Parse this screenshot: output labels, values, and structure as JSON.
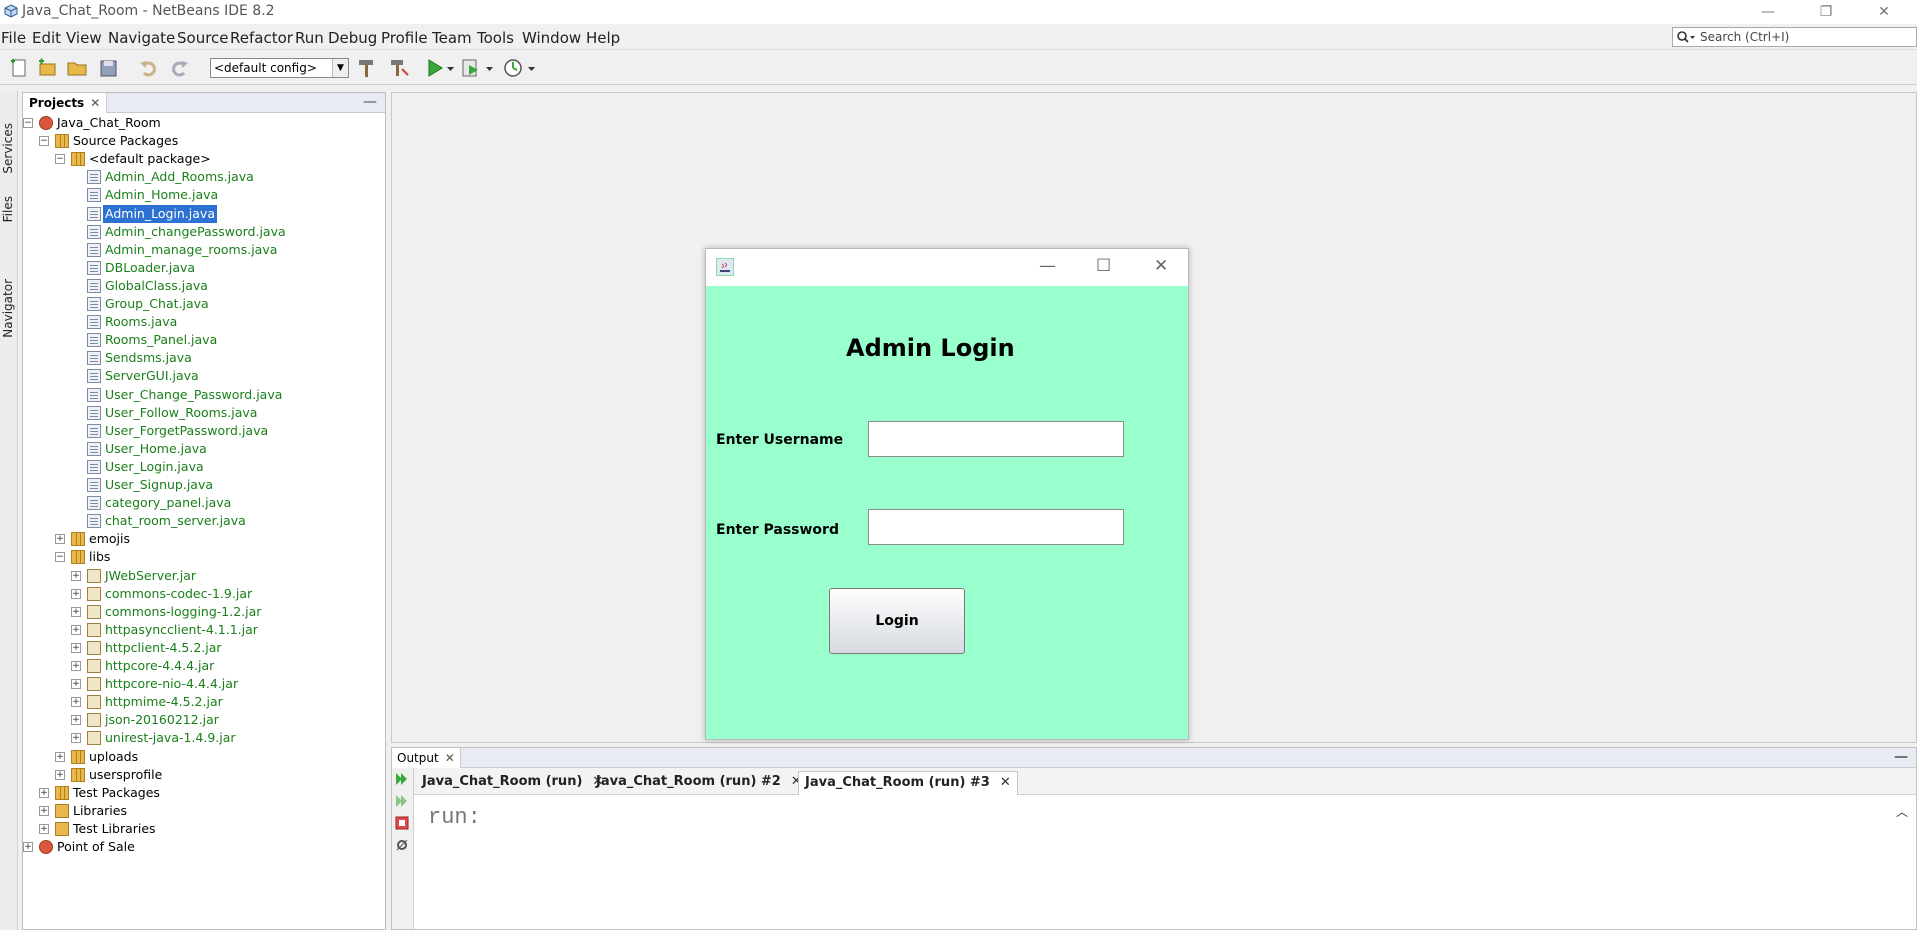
{
  "window": {
    "title": "Java_Chat_Room - NetBeans IDE 8.2",
    "minimize_glyph": "—",
    "restore_glyph": "❐",
    "close_glyph": "✕"
  },
  "menu": [
    "File",
    "Edit",
    "View",
    "Navigate",
    "Source",
    "Refactor",
    "Run",
    "Debug",
    "Profile",
    "Team",
    "Tools",
    "Window",
    "Help"
  ],
  "search": {
    "placeholder": "Search (Ctrl+I)"
  },
  "toolbar": {
    "config": "<default config>"
  },
  "side_tabs": [
    "Services",
    "Files",
    "Navigator"
  ],
  "projects_panel": {
    "title": "Projects",
    "close_glyph": "✕",
    "minimize_glyph": "—",
    "tree": [
      {
        "label": "Java_Chat_Room",
        "depth": 0,
        "toggle": "−",
        "icon": "project-icon",
        "kind": "node"
      },
      {
        "label": "Source Packages",
        "depth": 1,
        "toggle": "−",
        "icon": "source-packages-icon",
        "kind": "node"
      },
      {
        "label": "<default package>",
        "depth": 2,
        "toggle": "−",
        "icon": "package-icon",
        "kind": "node"
      },
      {
        "label": "Admin_Add_Rooms.java",
        "depth": 3,
        "icon": "java-form-icon",
        "kind": "file"
      },
      {
        "label": "Admin_Home.java",
        "depth": 3,
        "icon": "java-form-icon",
        "kind": "file"
      },
      {
        "label": "Admin_Login.java",
        "depth": 3,
        "icon": "java-form-icon",
        "kind": "file",
        "selected": true
      },
      {
        "label": "Admin_changePassword.java",
        "depth": 3,
        "icon": "java-form-icon",
        "kind": "file"
      },
      {
        "label": "Admin_manage_rooms.java",
        "depth": 3,
        "icon": "java-form-icon",
        "kind": "file"
      },
      {
        "label": "DBLoader.java",
        "depth": 3,
        "icon": "java-class-icon",
        "kind": "file"
      },
      {
        "label": "GlobalClass.java",
        "depth": 3,
        "icon": "java-class-icon",
        "kind": "file"
      },
      {
        "label": "Group_Chat.java",
        "depth": 3,
        "icon": "java-form-icon",
        "kind": "file"
      },
      {
        "label": "Rooms.java",
        "depth": 3,
        "icon": "java-class-icon",
        "kind": "file"
      },
      {
        "label": "Rooms_Panel.java",
        "depth": 3,
        "icon": "java-form-icon",
        "kind": "file"
      },
      {
        "label": "Sendsms.java",
        "depth": 3,
        "icon": "java-class-icon",
        "kind": "file"
      },
      {
        "label": "ServerGUI.java",
        "depth": 3,
        "icon": "java-form-icon",
        "kind": "file"
      },
      {
        "label": "User_Change_Password.java",
        "depth": 3,
        "icon": "java-form-icon",
        "kind": "file"
      },
      {
        "label": "User_Follow_Rooms.java",
        "depth": 3,
        "icon": "java-form-icon",
        "kind": "file"
      },
      {
        "label": "User_ForgetPassword.java",
        "depth": 3,
        "icon": "java-form-icon",
        "kind": "file"
      },
      {
        "label": "User_Home.java",
        "depth": 3,
        "icon": "java-form-icon",
        "kind": "file"
      },
      {
        "label": "User_Login.java",
        "depth": 3,
        "icon": "java-form-icon",
        "kind": "file"
      },
      {
        "label": "User_Signup.java",
        "depth": 3,
        "icon": "java-form-icon",
        "kind": "file"
      },
      {
        "label": "category_panel.java",
        "depth": 3,
        "icon": "java-form-icon",
        "kind": "file"
      },
      {
        "label": "chat_room_server.java",
        "depth": 3,
        "icon": "java-class-icon",
        "kind": "file"
      },
      {
        "label": "emojis",
        "depth": 2,
        "toggle": "+",
        "icon": "package-icon",
        "kind": "node"
      },
      {
        "label": "libs",
        "depth": 2,
        "toggle": "−",
        "icon": "package-icon",
        "kind": "node"
      },
      {
        "label": "JWebServer.jar",
        "depth": 3,
        "toggle": "+",
        "icon": "jar-icon",
        "kind": "file"
      },
      {
        "label": "commons-codec-1.9.jar",
        "depth": 3,
        "toggle": "+",
        "icon": "jar-icon",
        "kind": "file"
      },
      {
        "label": "commons-logging-1.2.jar",
        "depth": 3,
        "toggle": "+",
        "icon": "jar-icon",
        "kind": "file"
      },
      {
        "label": "httpasyncclient-4.1.1.jar",
        "depth": 3,
        "toggle": "+",
        "icon": "jar-icon",
        "kind": "file"
      },
      {
        "label": "httpclient-4.5.2.jar",
        "depth": 3,
        "toggle": "+",
        "icon": "jar-icon",
        "kind": "file"
      },
      {
        "label": "httpcore-4.4.4.jar",
        "depth": 3,
        "toggle": "+",
        "icon": "jar-icon",
        "kind": "file"
      },
      {
        "label": "httpcore-nio-4.4.4.jar",
        "depth": 3,
        "toggle": "+",
        "icon": "jar-icon",
        "kind": "file"
      },
      {
        "label": "httpmime-4.5.2.jar",
        "depth": 3,
        "toggle": "+",
        "icon": "jar-icon",
        "kind": "file"
      },
      {
        "label": "json-20160212.jar",
        "depth": 3,
        "toggle": "+",
        "icon": "jar-icon",
        "kind": "file"
      },
      {
        "label": "unirest-java-1.4.9.jar",
        "depth": 3,
        "toggle": "+",
        "icon": "jar-icon",
        "kind": "file"
      },
      {
        "label": "uploads",
        "depth": 2,
        "toggle": "+",
        "icon": "package-icon",
        "kind": "node"
      },
      {
        "label": "usersprofile",
        "depth": 2,
        "toggle": "+",
        "icon": "package-icon",
        "kind": "node"
      },
      {
        "label": "Test Packages",
        "depth": 1,
        "toggle": "+",
        "icon": "test-packages-icon",
        "kind": "node"
      },
      {
        "label": "Libraries",
        "depth": 1,
        "toggle": "+",
        "icon": "libraries-icon",
        "kind": "node"
      },
      {
        "label": "Test Libraries",
        "depth": 1,
        "toggle": "+",
        "icon": "test-libraries-icon",
        "kind": "node"
      },
      {
        "label": "Point of Sale",
        "depth": 0,
        "toggle": "+",
        "icon": "project-icon",
        "kind": "node"
      }
    ]
  },
  "login_window": {
    "title": "Admin Login",
    "username_label": "Enter Username",
    "username_value": "",
    "password_label": "Enter Password",
    "password_value": "",
    "login_button": "Login",
    "minimize_glyph": "—",
    "maximize_glyph": "☐",
    "close_glyph": "✕",
    "background_color": "#99ffcc"
  },
  "output_panel": {
    "title": "Output",
    "close_glyph": "✕",
    "minimize_glyph": "—",
    "tabs": [
      {
        "label": "Java_Chat_Room (run)",
        "active": false
      },
      {
        "label": "Java_Chat_Room (run) #2",
        "active": false
      },
      {
        "label": "Java_Chat_Room (run) #3",
        "active": true
      }
    ],
    "tab_close_glyph": "✕",
    "console_text": "run:",
    "scroll_up_glyph": "︿"
  },
  "colors": {
    "selection": "#2d72d2",
    "file_text": "#1a7f1a",
    "form_background": "#99ffcc"
  }
}
